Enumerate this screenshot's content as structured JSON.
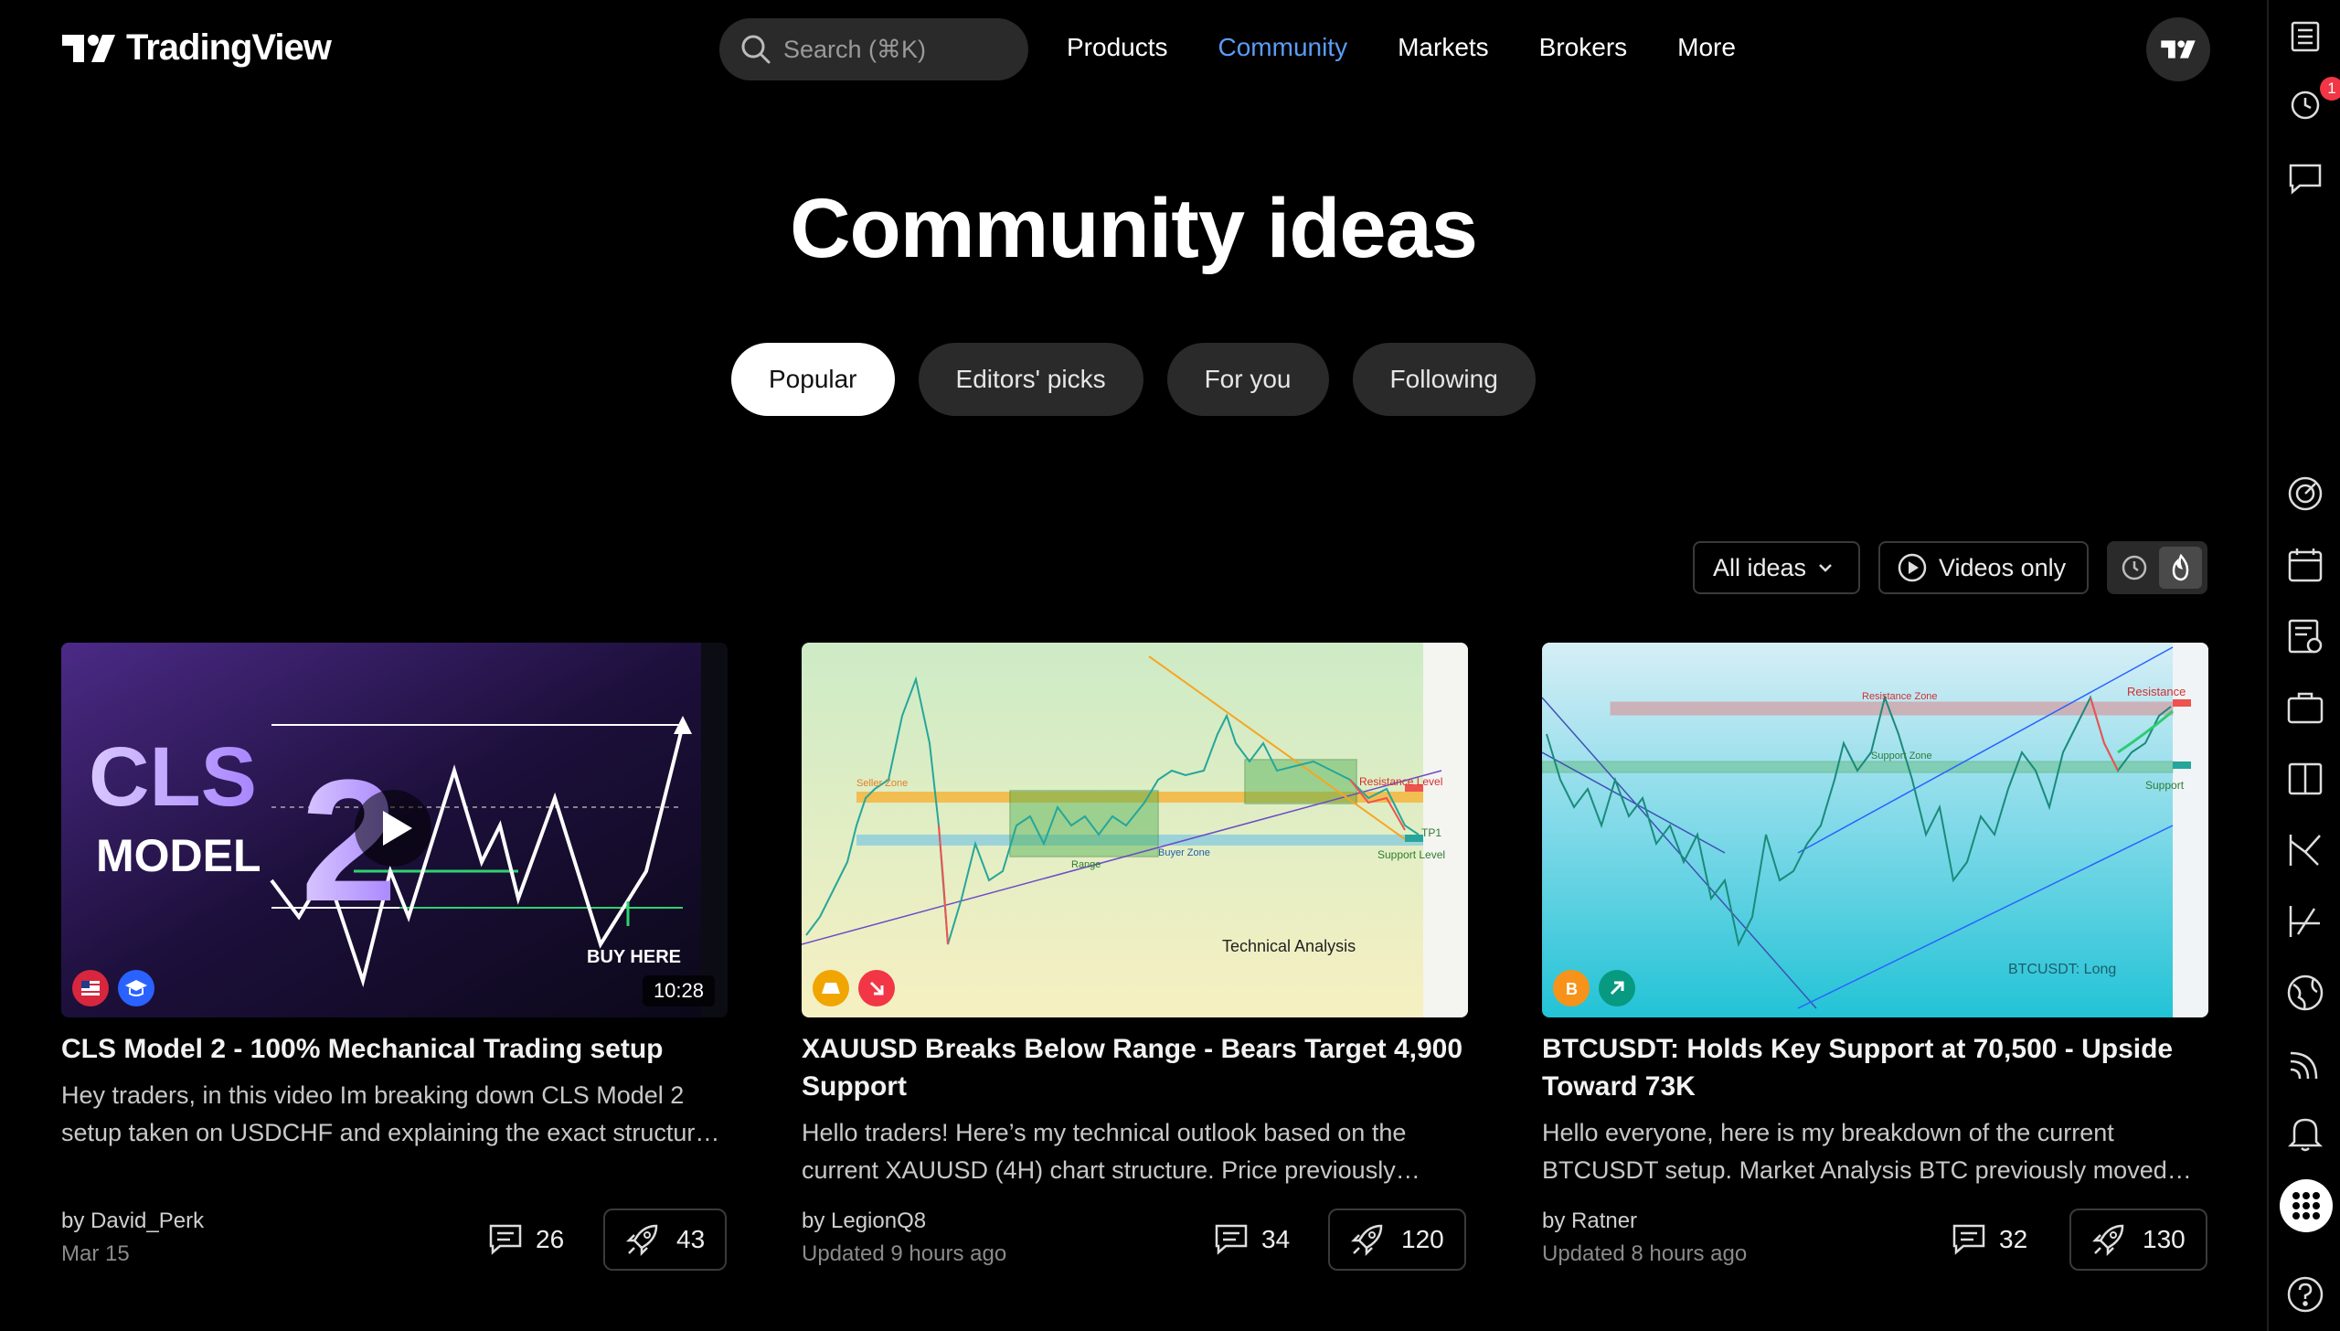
{
  "header": {
    "logo_text": "TradingView",
    "search_placeholder": "Search (⌘K)",
    "nav": [
      "Products",
      "Community",
      "Markets",
      "Brokers",
      "More"
    ],
    "active_nav": "Community"
  },
  "rail": {
    "alerts_badge": "1",
    "icons": [
      "watchlist-icon",
      "alerts-icon",
      "chats-icon",
      "screener-icon",
      "calendar-icon",
      "news-icon",
      "portfolio-icon",
      "compare-icon",
      "pine-icon",
      "strategy-icon",
      "globe-icon",
      "stream-icon",
      "notifications-icon",
      "apps-icon",
      "help-icon"
    ]
  },
  "main": {
    "title": "Community ideas",
    "tabs": [
      "Popular",
      "Editors' picks",
      "For you",
      "Following"
    ],
    "active_tab": "Popular",
    "filters": {
      "all_ideas": "All ideas",
      "videos_only": "Videos only"
    }
  },
  "cards": [
    {
      "title": "CLS Model 2 - 100% Mechanical Trading setup",
      "description": "Hey traders, in this video Im breaking down CLS Model 2 setup taken on USDCHF and explaining the exact structure and process behind this trade. Pay attention what I say in this video.",
      "author": "by David_Perk",
      "date": "Mar 15",
      "comments": "26",
      "boosts": "43",
      "duration": "10:28",
      "thumb_text": {
        "line1": "CLS",
        "line2": "MODEL",
        "big": "2",
        "cta": "BUY HERE"
      }
    },
    {
      "title": "XAUUSD Breaks Below Range - Bears Target 4,900 Support",
      "description": "Hello traders! Here’s my technical outlook based on the current XAUUSD (4H) chart structure. Price previously traded inside a range.",
      "author": "by LegionQ8",
      "date": "Updated 9 hours ago",
      "comments": "34",
      "boosts": "120",
      "thumb_text": {
        "seller": "Seller Zone",
        "buyer": "Buyer Zone",
        "resistance": "Resistance Level",
        "support": "Support Level",
        "tp": "TP1",
        "range": "Range",
        "caption": "Technical Analysis"
      }
    },
    {
      "title": "BTCUSDT: Holds Key Support at 70,500 - Upside Toward 73K",
      "description": "Hello everyone, here is my breakdown of the current BTCUSDT setup. Market Analysis BTC previously moved inside a descending channel.",
      "author": "by Ratner",
      "date": "Updated 8 hours ago",
      "comments": "32",
      "boosts": "130",
      "thumb_text": {
        "resistance_zone": "Resistance Zone",
        "resistance": "Resistance",
        "support_zone": "Support Zone",
        "support": "Support",
        "caption": "BTCUSDT: Long"
      }
    }
  ]
}
